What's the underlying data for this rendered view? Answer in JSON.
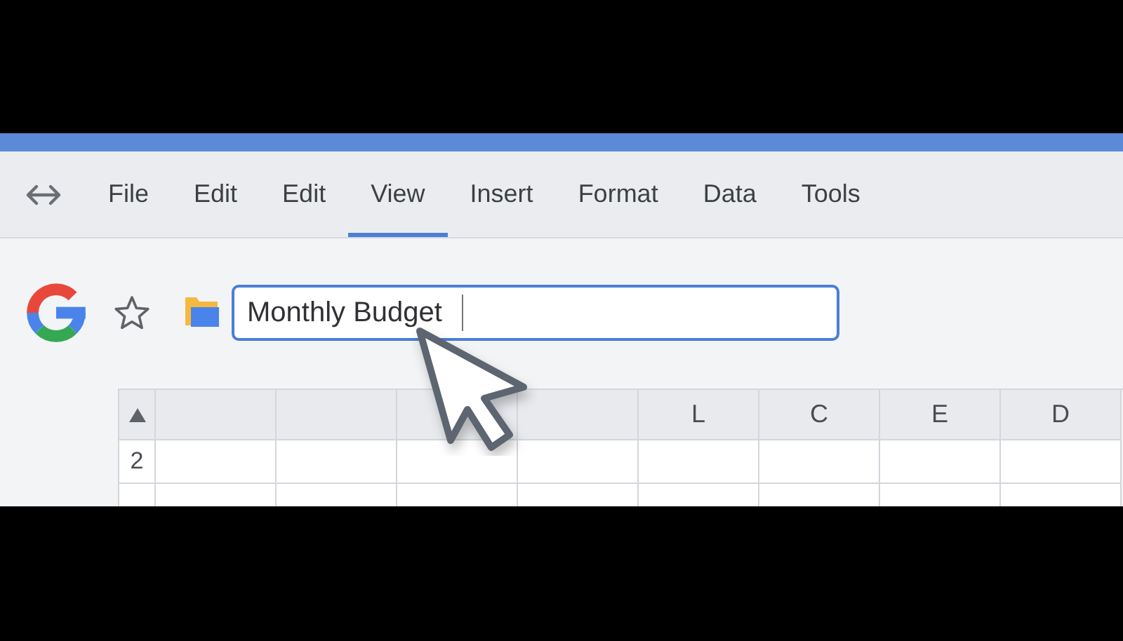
{
  "menu": {
    "items": [
      {
        "label": "File",
        "selected": false
      },
      {
        "label": "Edit",
        "selected": false
      },
      {
        "label": "Edit",
        "selected": false
      },
      {
        "label": "View",
        "selected": true
      },
      {
        "label": "Insert",
        "selected": false
      },
      {
        "label": "Format",
        "selected": false
      },
      {
        "label": "Data",
        "selected": false
      },
      {
        "label": "Tools",
        "selected": false
      }
    ]
  },
  "title_field": {
    "value": "Monthly Budget"
  },
  "sheet": {
    "columns": [
      {},
      {},
      {},
      {},
      {
        "label": "L"
      },
      {
        "label": "C"
      },
      {
        "label": "E"
      },
      {
        "label": "D"
      }
    ],
    "rows": [
      {
        "number": "2"
      },
      {}
    ]
  }
}
